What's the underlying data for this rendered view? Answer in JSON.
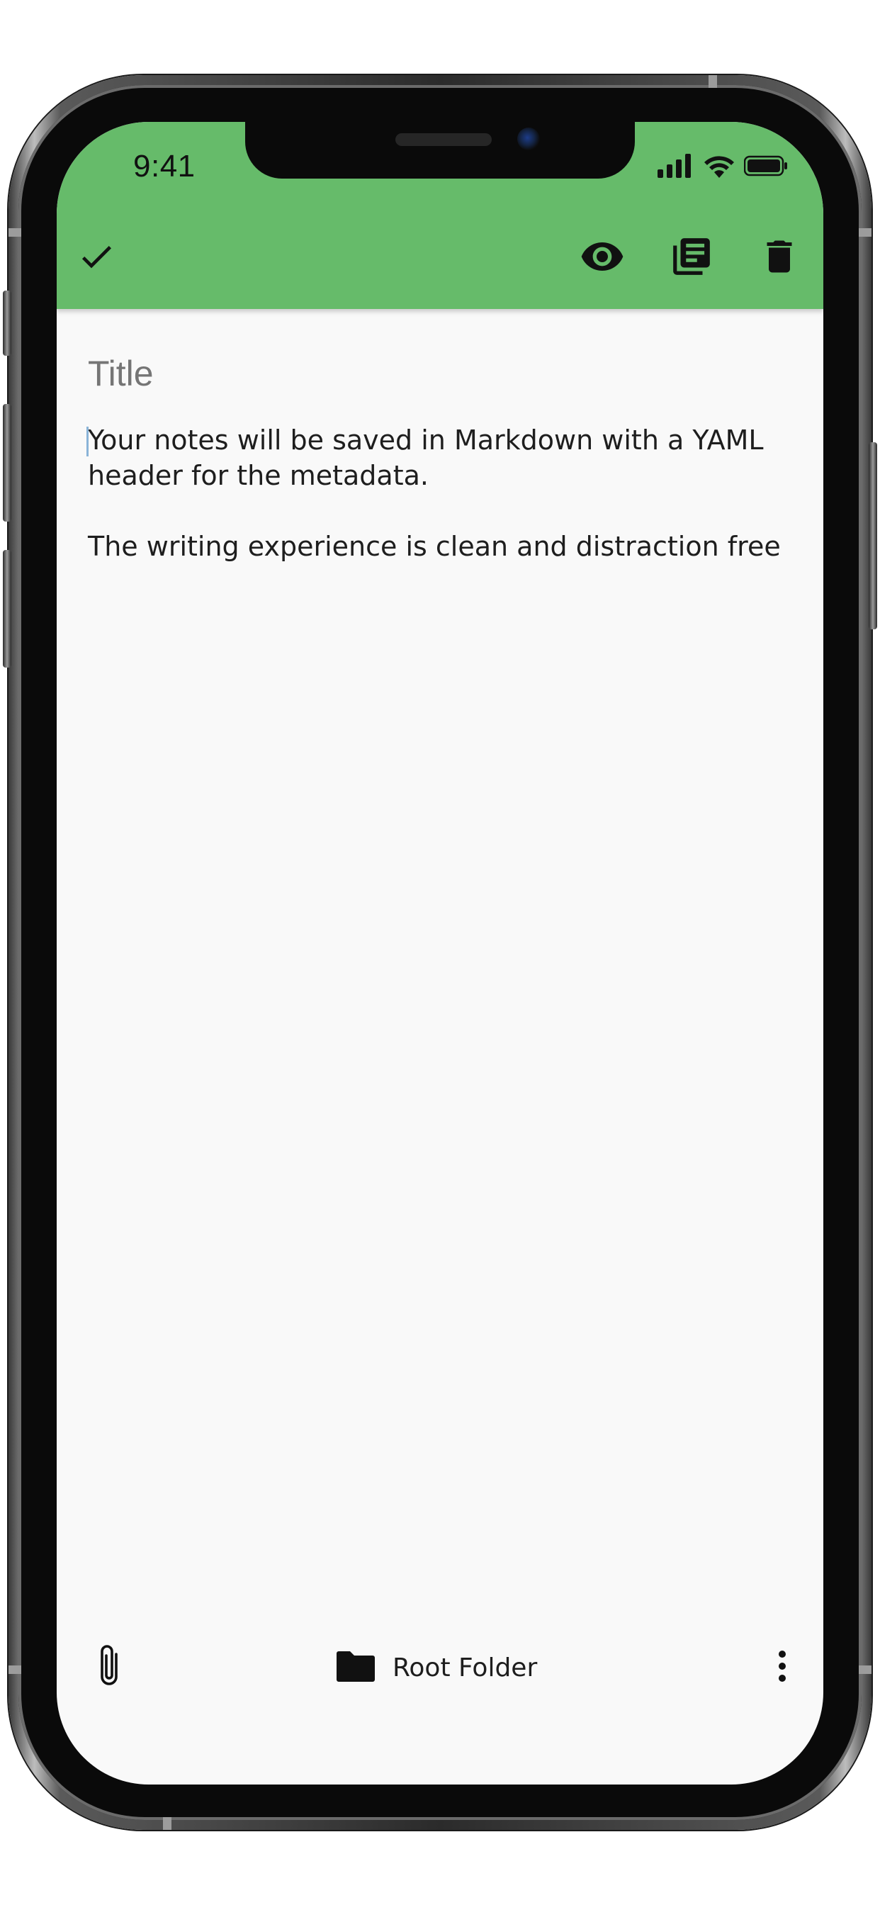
{
  "status_bar": {
    "time": "9:41",
    "icons": [
      "cellular-signal-icon",
      "wifi-icon",
      "battery-icon"
    ]
  },
  "toolbar": {
    "background": "#66bb6a",
    "left_action": "check-icon",
    "right_actions": [
      "eye-icon",
      "library-books-icon",
      "trash-icon"
    ]
  },
  "editor": {
    "title_placeholder": "Title",
    "title_value": "",
    "body_paragraphs": [
      "Your notes will be saved in Markdown with a YAML header for the metadata.",
      "The writing experience is clean and distraction free"
    ]
  },
  "bottom_bar": {
    "attach_icon": "paperclip-icon",
    "folder_icon": "folder-icon",
    "folder_label": "Root Folder",
    "more_icon": "more-vert-icon"
  },
  "colors": {
    "accent": "#66bb6a",
    "background": "#f9f9f9",
    "text": "#1e1e1e",
    "placeholder": "#7a7a7a"
  }
}
